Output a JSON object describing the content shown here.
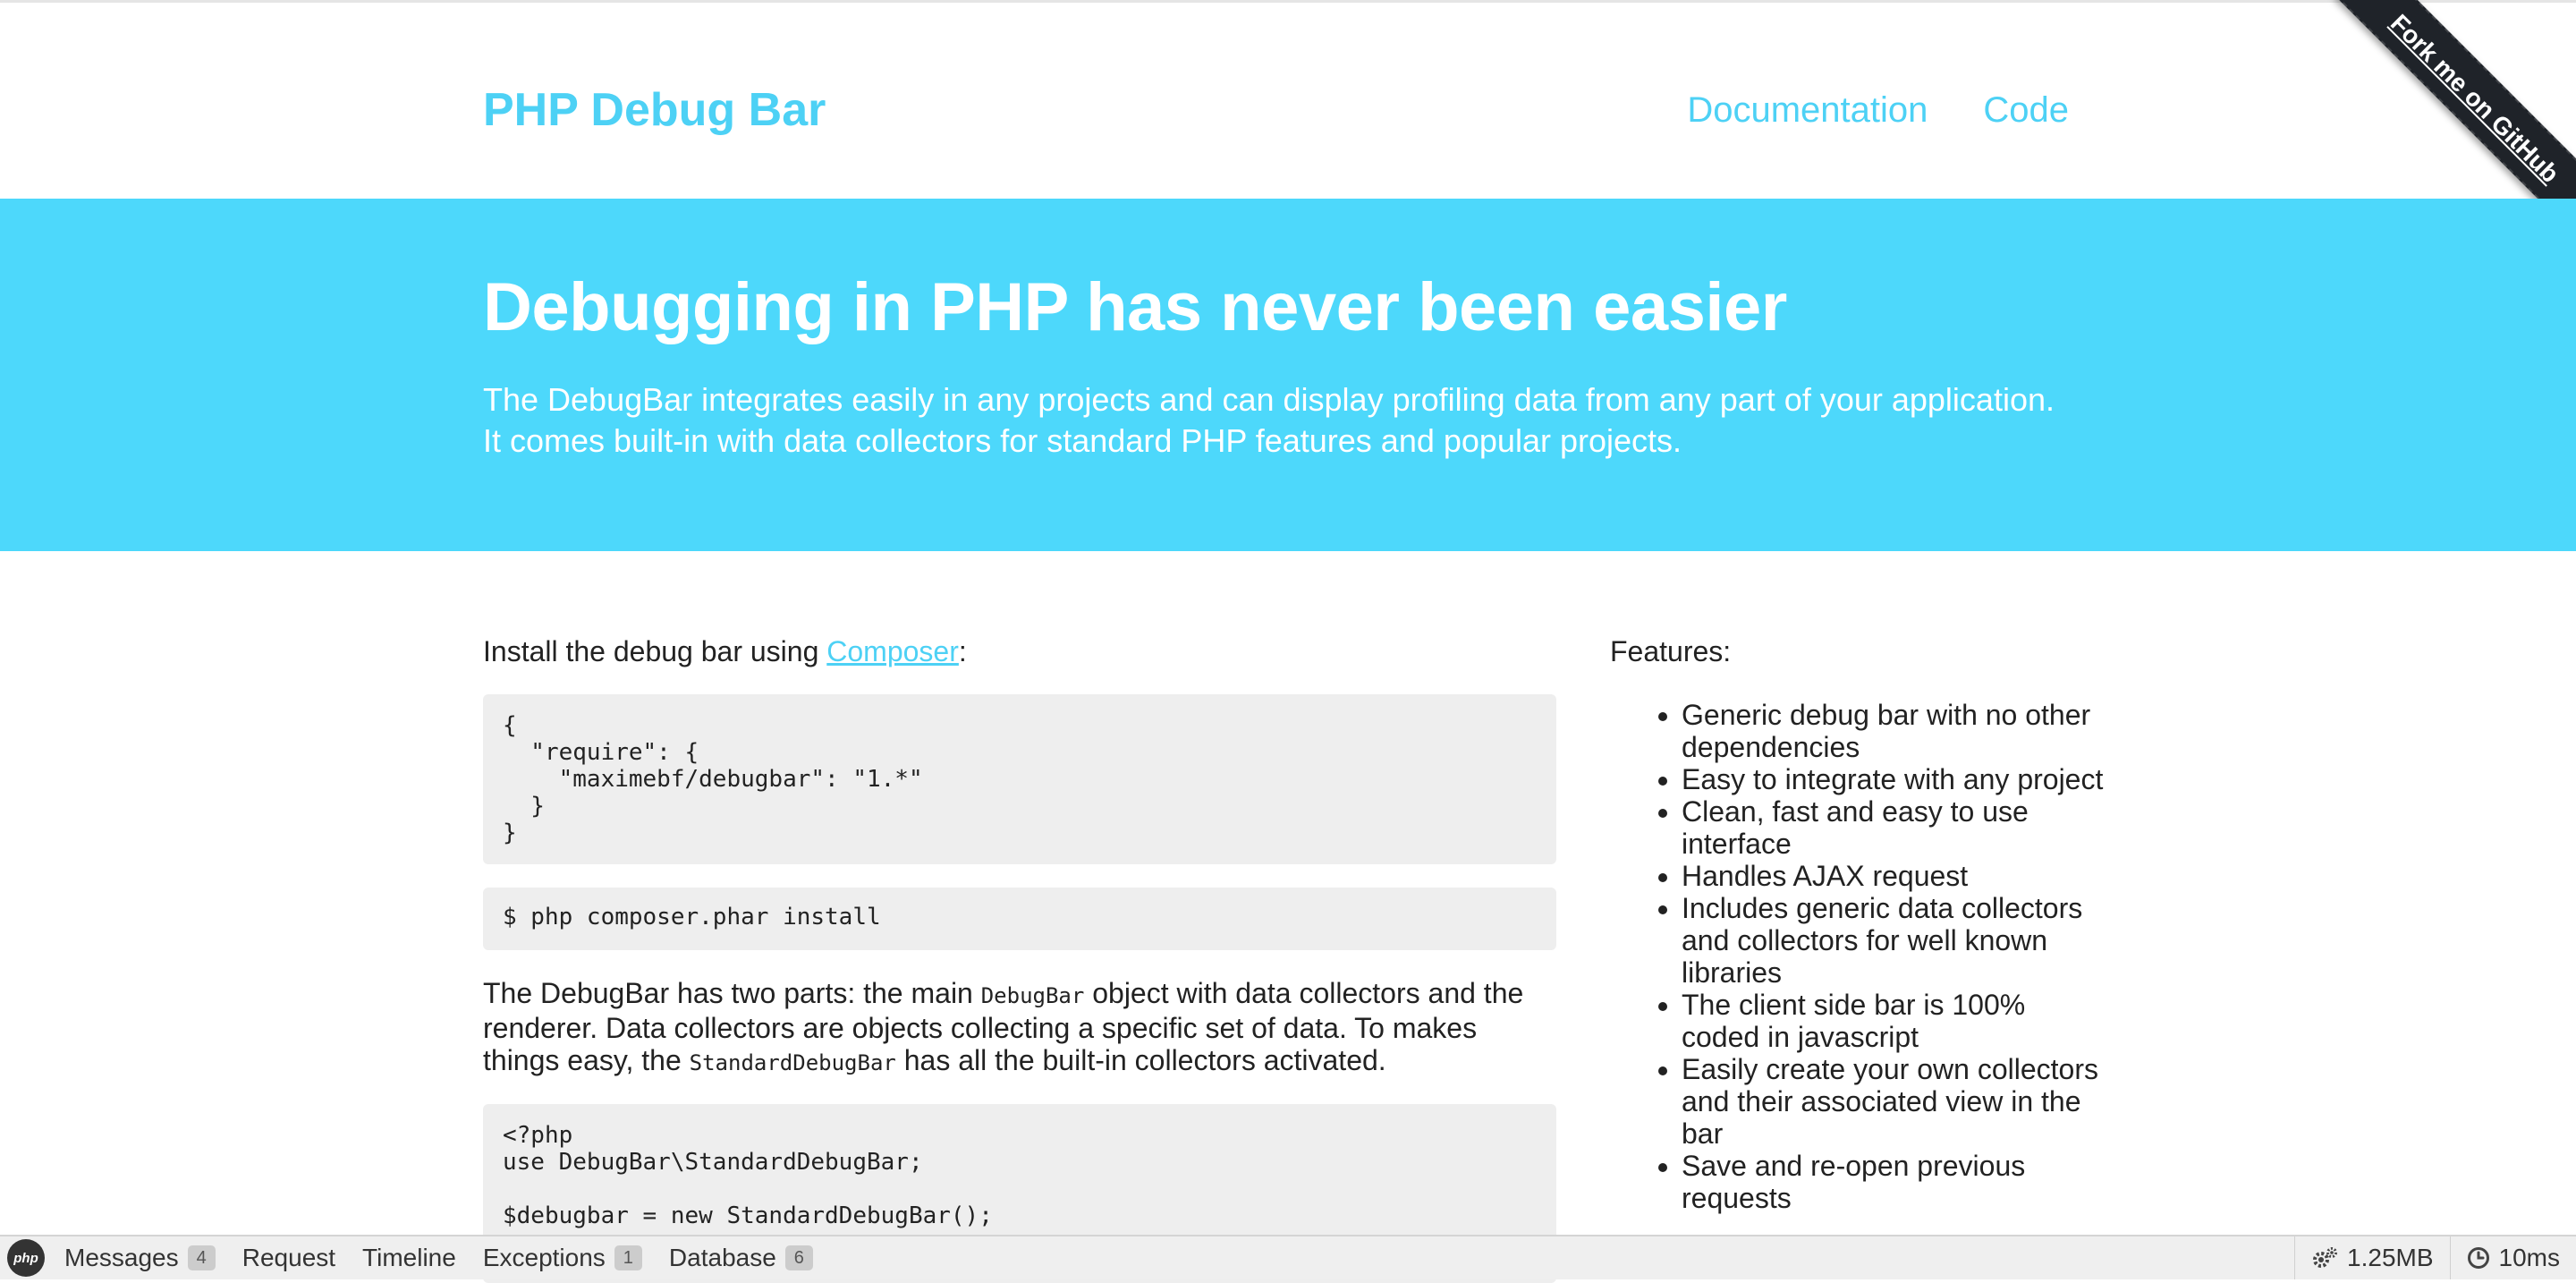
{
  "header": {
    "brand": "PHP Debug Bar",
    "nav": [
      "Documentation",
      "Code"
    ],
    "ribbon": "Fork me on GitHub"
  },
  "hero": {
    "title": "Debugging in PHP has never been easier",
    "text": "The DebugBar integrates easily in any projects and can display profiling data from any part of your application. It comes built-in with data collectors for standard PHP features and popular projects."
  },
  "main": {
    "install_prefix": "Install the debug bar using ",
    "install_link": "Composer",
    "install_suffix": ":",
    "code_json": "{\n  \"require\": {\n    \"maximebf/debugbar\": \"1.*\"\n  }\n}",
    "code_install": "$ php composer.phar install",
    "para_part1": "The DebugBar has two parts: the main ",
    "para_code1": "DebugBar",
    "para_part2": " object with data collectors and the renderer. Data collectors are objects collecting a specific set of data. To makes things easy, the ",
    "para_code2": "StandardDebugBar",
    "para_part3": " has all the built-in collectors activated.",
    "code_php": "<?php\nuse DebugBar\\StandardDebugBar;\n\n$debugbar = new StandardDebugBar();"
  },
  "features": {
    "title": "Features:",
    "items": [
      "Generic debug bar with no other dependencies",
      "Easy to integrate with any project",
      "Clean, fast and easy to use interface",
      "Handles AJAX request",
      "Includes generic data collectors and collectors for well known libraries",
      "The client side bar is 100% coded in javascript",
      "Easily create your own collectors and their associated view in the bar",
      "Save and re-open previous requests"
    ]
  },
  "debugbar": {
    "logo": "php",
    "tabs": [
      {
        "label": "Messages",
        "badge": "4"
      },
      {
        "label": "Request",
        "badge": ""
      },
      {
        "label": "Timeline",
        "badge": ""
      },
      {
        "label": "Exceptions",
        "badge": "1"
      },
      {
        "label": "Database",
        "badge": "6"
      }
    ],
    "memory": "1.25MB",
    "time": "10ms",
    "memory_icon": "gears-icon",
    "time_icon": "clock-icon"
  },
  "colors": {
    "accent": "#4dd1f5",
    "hero_bg": "#4dd8fb",
    "code_bg": "#eeeeee",
    "debugbar_bg": "#efefef"
  }
}
